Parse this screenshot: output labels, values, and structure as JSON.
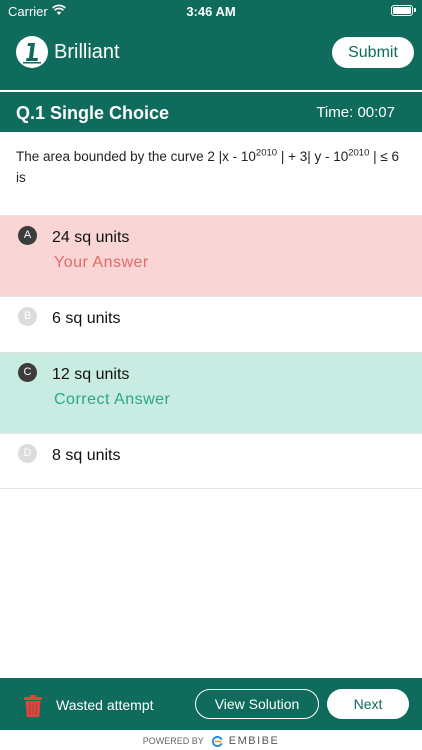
{
  "status_bar": {
    "carrier": "Carrier",
    "time": "3:46 AM"
  },
  "header": {
    "app_name": "Brilliant",
    "submit_label": "Submit",
    "logo_icon": "brilliant-logo"
  },
  "question": {
    "type_label": "Q.1 Single Choice",
    "timer_label": "Time:",
    "timer_value": "00:07",
    "text_part1": "The area bounded by the curve 2 |x - 10",
    "exp1": "2010",
    "text_part2": " | + 3| y - 10",
    "exp2": "2010",
    "text_part3": " | ≤ 6 is"
  },
  "options": [
    {
      "letter": "A",
      "text": "24 sq units",
      "note": "Your Answer",
      "state": "wrong"
    },
    {
      "letter": "B",
      "text": "6 sq units",
      "note": "",
      "state": "none"
    },
    {
      "letter": "C",
      "text": "12 sq units",
      "note": "Correct Answer",
      "state": "correct"
    },
    {
      "letter": "D",
      "text": "8 sq units",
      "note": "",
      "state": "none"
    }
  ],
  "bottom_bar": {
    "wasted_label": "Wasted attempt",
    "view_solution_label": "View Solution",
    "next_label": "Next"
  },
  "footer": {
    "powered_by": "POWERED BY",
    "brand": "EMBIBE"
  },
  "colors": {
    "brand": "#0f6b5b",
    "wrong_bg": "#f9d6d5",
    "wrong_text": "#e36a65",
    "correct_bg": "#c8ebe2",
    "correct_text": "#2ba784",
    "trash": "#e0443a"
  }
}
